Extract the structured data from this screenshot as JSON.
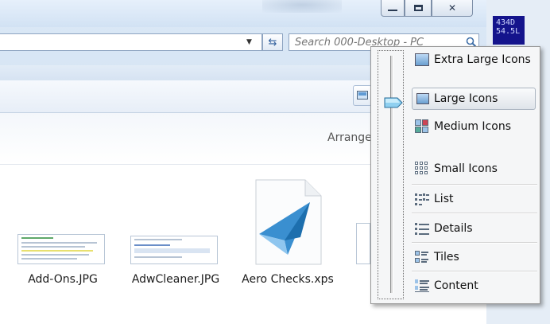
{
  "window": {
    "search_placeholder": "Search 000-Desktop - PC",
    "arrange_label": "Arrange"
  },
  "files": [
    {
      "name": "Add-Ons.JPG"
    },
    {
      "name": "AdwCleaner.JPG"
    },
    {
      "name": "Aero Checks.xps"
    }
  ],
  "desktop": {
    "gadget_text_line1": "434D",
    "gadget_text_line2": "54.5L"
  },
  "view_menu": {
    "items": [
      {
        "label": "Extra Large Icons",
        "icon": "extra-large-icons-icon"
      },
      {
        "label": "Large Icons",
        "icon": "large-icons-icon",
        "selected": true
      },
      {
        "label": "Medium Icons",
        "icon": "medium-icons-icon"
      },
      {
        "label": "Small Icons",
        "icon": "small-icons-icon"
      },
      {
        "label": "List",
        "icon": "list-icon"
      },
      {
        "label": "Details",
        "icon": "details-icon"
      },
      {
        "label": "Tiles",
        "icon": "tiles-icon"
      },
      {
        "label": "Content",
        "icon": "content-icon"
      }
    ]
  },
  "colors": {
    "accent": "#3a8fd0",
    "menu_bg": "#f5f6f7",
    "selection_border": "#aab4c0"
  }
}
